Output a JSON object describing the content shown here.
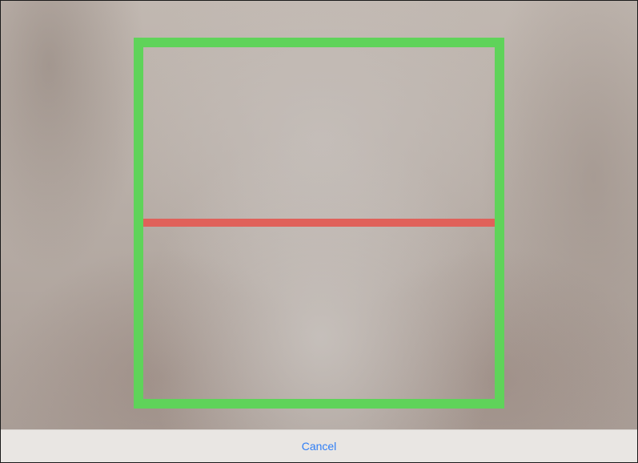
{
  "toolbar": {
    "cancel_label": "Cancel"
  },
  "colors": {
    "scan_frame": "#5fd35a",
    "scan_line": "#e0615a",
    "cancel_text": "#2f7ef6",
    "toolbar_bg": "#e9e6e3"
  }
}
